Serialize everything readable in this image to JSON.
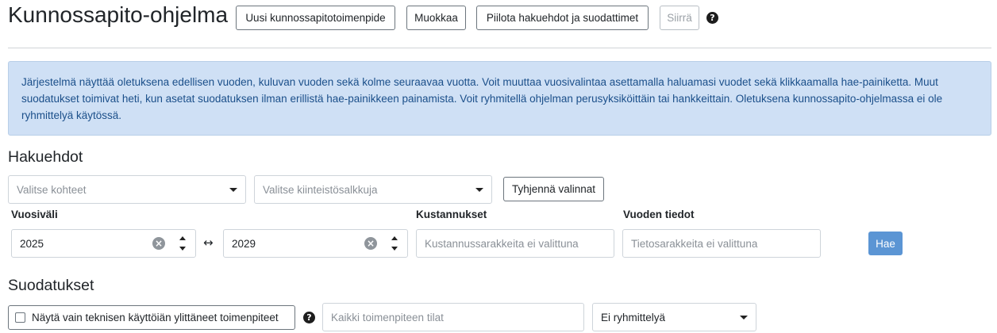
{
  "header": {
    "title": "Kunnossapito-ohjelma",
    "buttons": {
      "new": "Uusi kunnossapitotoimenpide",
      "edit": "Muokkaa",
      "hide": "Piilota hakuehdot ja suodattimet",
      "move": "Siirrä"
    },
    "help_icon": "?"
  },
  "info": {
    "text": "Järjestelmä näyttää oletuksena edellisen vuoden, kuluvan vuoden sekä kolme seuraavaa vuotta. Voit muuttaa vuosivalintaa asettamalla haluamasi vuodet sekä klikkaamalla hae-painiketta. Muut suodatukset toimivat heti, kun asetat suodatuksen ilman erillistä hae-painikkeen painamista. Voit ryhmitellä ohjelman perusyksiköittäin tai hankkeittain. Oletuksena kunnossapito-ohjelmassa ei ole ryhmittelyä käytössä."
  },
  "search": {
    "title": "Hakuehdot",
    "targets_placeholder": "Valitse kohteet",
    "property_groups_placeholder": "Valitse kiinteistösalkkuja",
    "clear_button": "Tyhjennä valinnat",
    "year_range_label": "Vuosiväli",
    "year_from": "2025",
    "range_arrow": "↔",
    "year_to": "2029",
    "costs_label": "Kustannukset",
    "costs_placeholder": "Kustannussarakkeita ei valittuna",
    "year_data_label": "Vuoden tiedot",
    "year_data_placeholder": "Tietosarakkeita ei valittuna",
    "search_button": "Hae",
    "clear_glyph": "×"
  },
  "filters": {
    "title": "Suodatukset",
    "technical_life_checkbox": "Näytä vain teknisen käyttöiän ylittäneet toimenpiteet",
    "status_placeholder": "Kaikki toimenpiteen tilat",
    "grouping_value": "Ei ryhmittelyä",
    "help_icon": "?"
  },
  "icons": {
    "help": "help-circle-icon",
    "clear": "clear-circle-icon",
    "caret": "chevron-down-icon",
    "spinner": "spinner-arrows-icon"
  },
  "colors": {
    "info_bg": "#cfe0f5",
    "info_text": "#1b4f8a",
    "primary": "#5b95d4"
  }
}
